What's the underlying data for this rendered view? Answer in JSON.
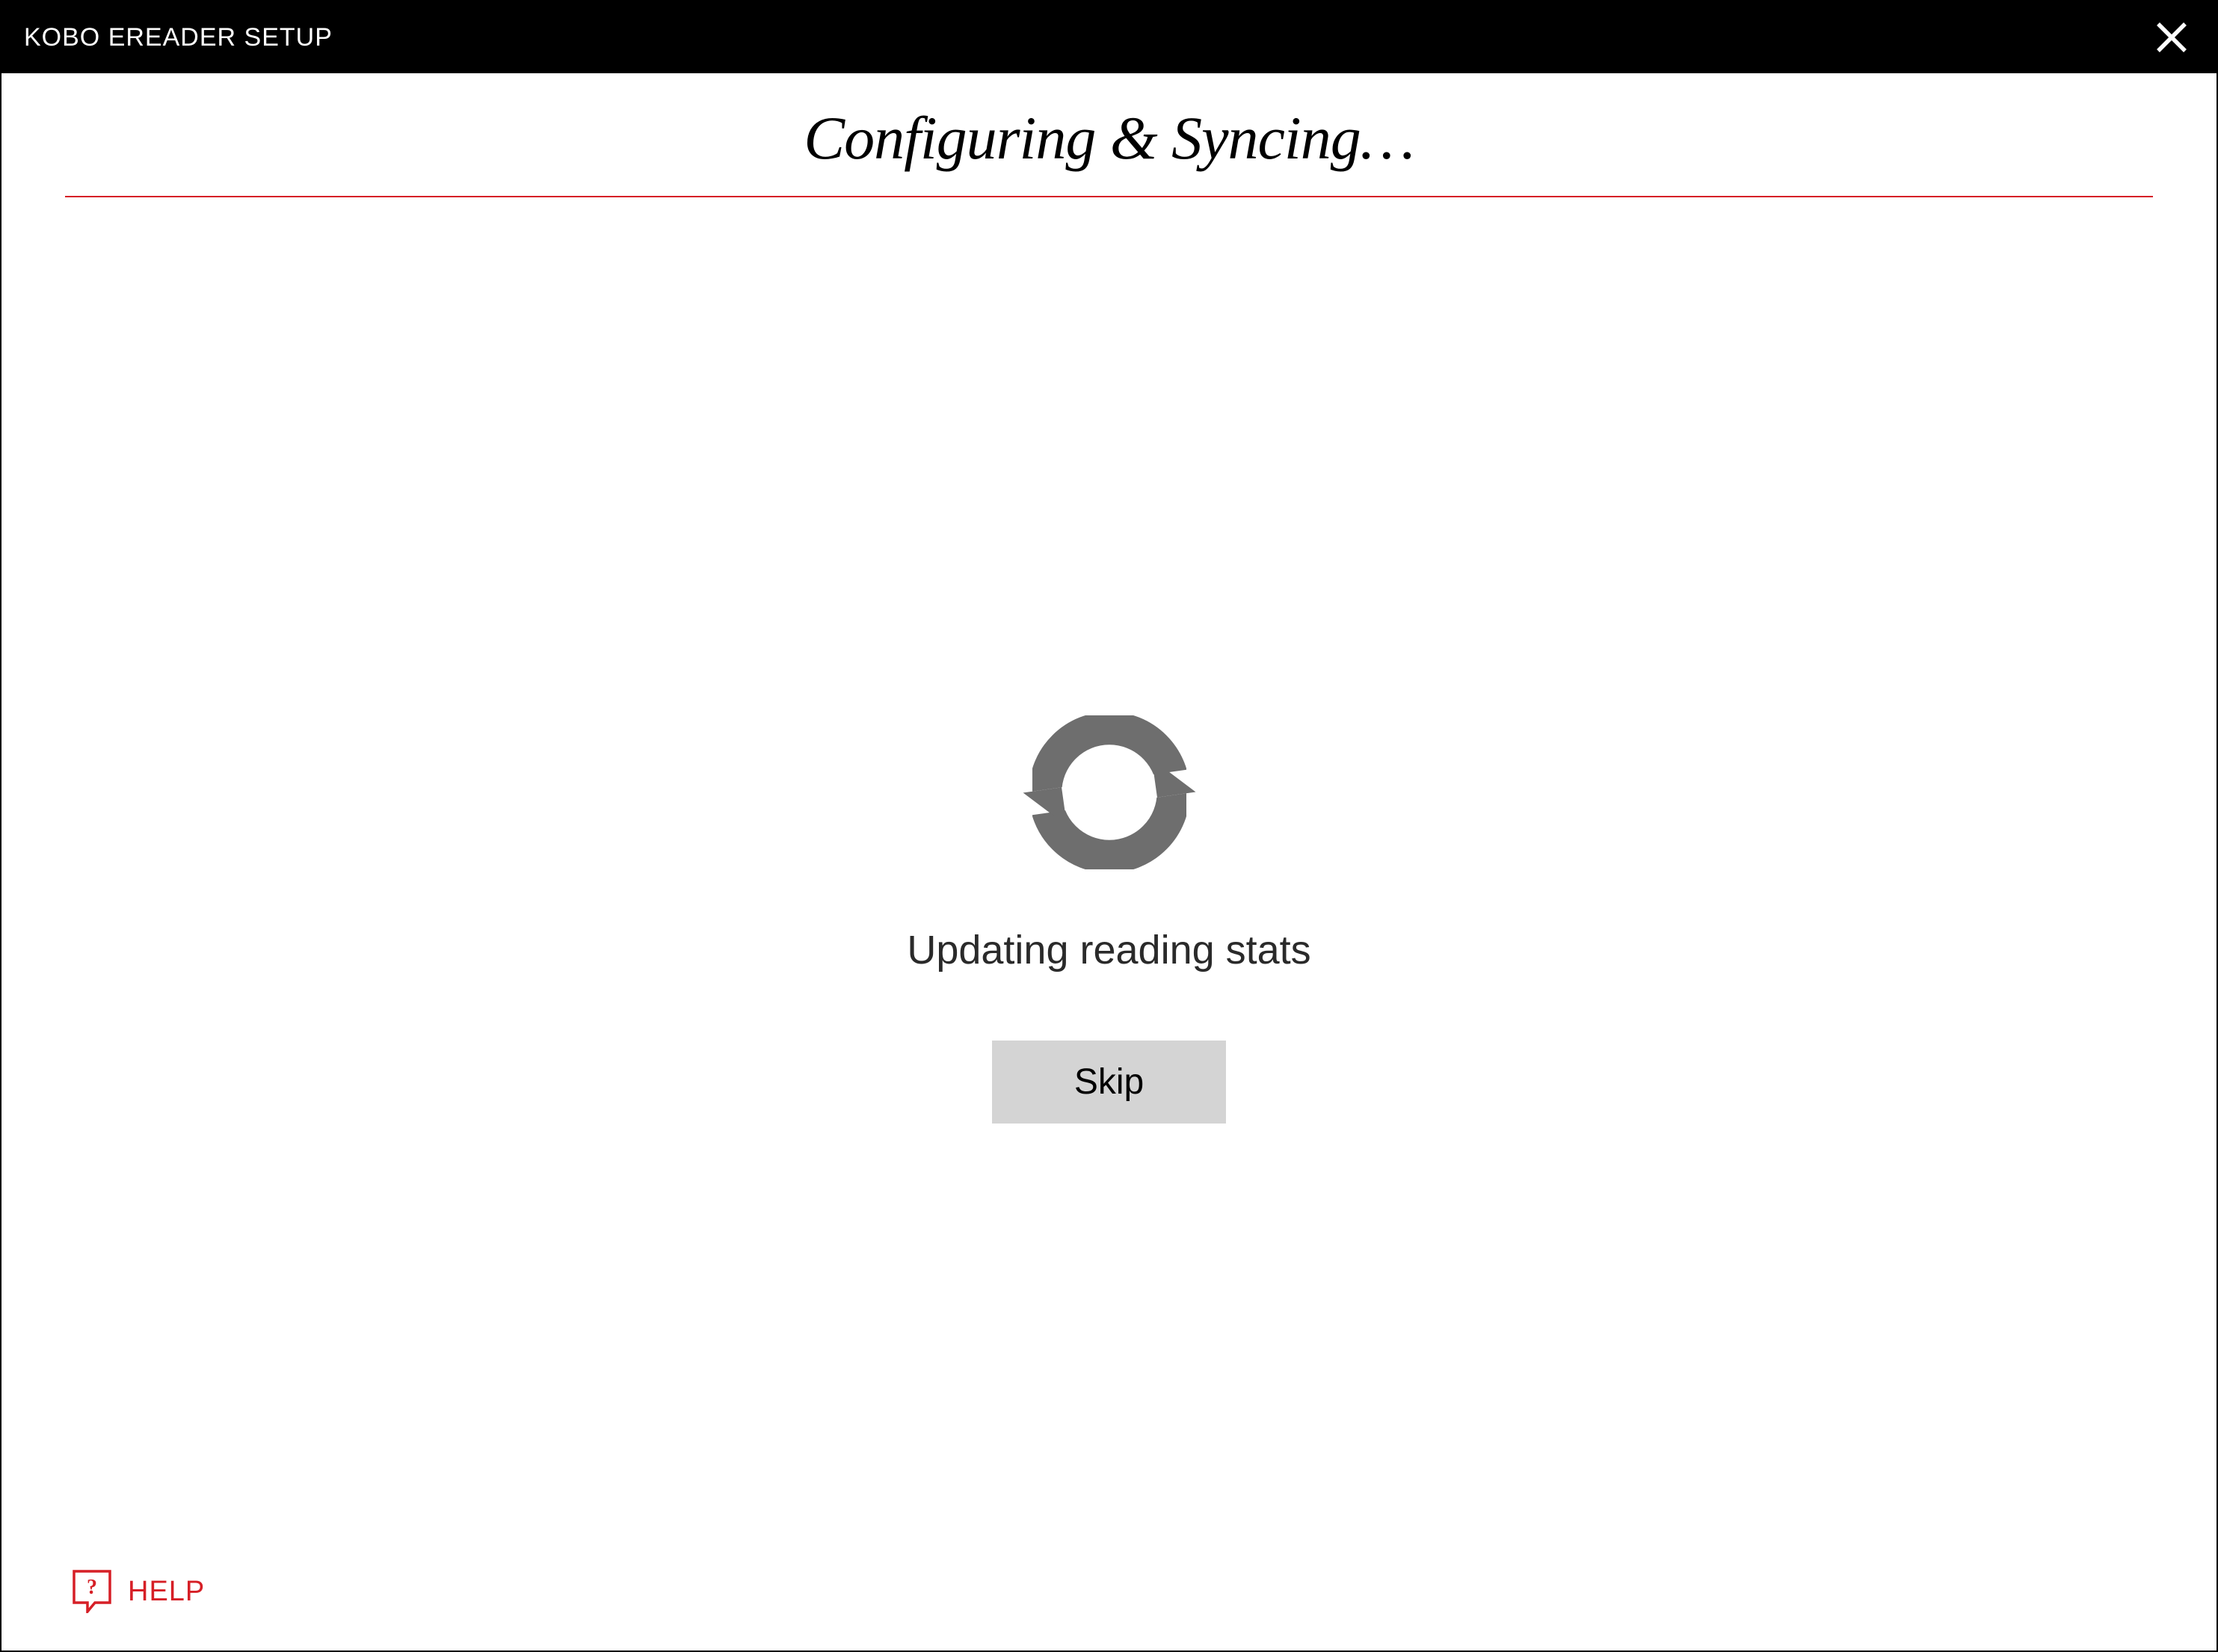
{
  "window": {
    "title": "KOBO EREADER SETUP"
  },
  "heading": "Configuring & Syncing…",
  "status": "Updating reading stats",
  "buttons": {
    "skip": "Skip"
  },
  "help": {
    "label": "HELP"
  },
  "colors": {
    "accent": "#d61f26",
    "icon_gray": "#6e6e6e",
    "button_bg": "#d4d4d4"
  }
}
